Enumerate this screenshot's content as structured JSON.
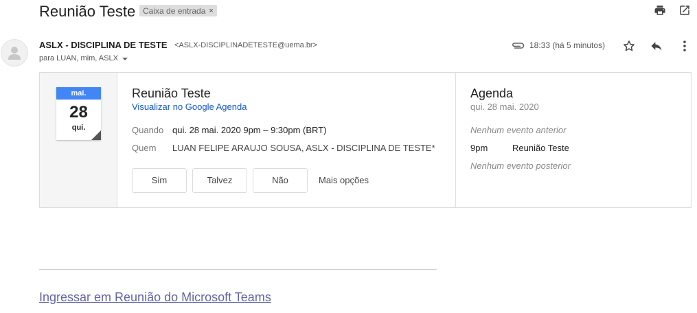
{
  "email": {
    "subject": "Reunião Teste",
    "label": "Caixa de entrada",
    "sender_name": "ASLX - DISCIPLINA DE TESTE",
    "sender_email": "<ASLX-DISCIPLINADETESTE@uema.br>",
    "recipients": "para LUAN, mim, ASLX",
    "time": "18:33 (há 5 minutos)"
  },
  "invite": {
    "cal_month": "mai.",
    "cal_day": "28",
    "cal_dow": "qui.",
    "title": "Reunião Teste",
    "calendar_link": "Visualizar no Google Agenda",
    "when_label": "Quando",
    "when_value": "qui. 28 mai. 2020 9pm – 9:30pm (BRT)",
    "who_label": "Quem",
    "who_value": "LUAN FELIPE ARAUJO SOUSA, ASLX - DISCIPLINA DE TESTE*",
    "buttons": {
      "yes": "Sim",
      "maybe": "Talvez",
      "no": "Não",
      "more": "Mais opções"
    }
  },
  "agenda": {
    "title": "Agenda",
    "date": "qui. 28 mai. 2020",
    "no_prev": "Nenhum evento anterior",
    "event_time": "9pm",
    "event_name": "Reunião Teste",
    "no_next": "Nenhum evento posterior"
  },
  "body": {
    "teams_link": "Ingressar em Reunião do Microsoft Teams"
  },
  "icons": {
    "print": "print-icon",
    "new_window": "open-in-new-window-icon",
    "avatar": "person-icon",
    "attachment": "paperclip-icon",
    "star": "star-icon",
    "reply": "reply-icon",
    "more": "more-vertical-icon"
  },
  "colors": {
    "calendar_blue": "#4285f4",
    "link_blue": "#1155cc",
    "teams_purple": "#6264a7"
  }
}
